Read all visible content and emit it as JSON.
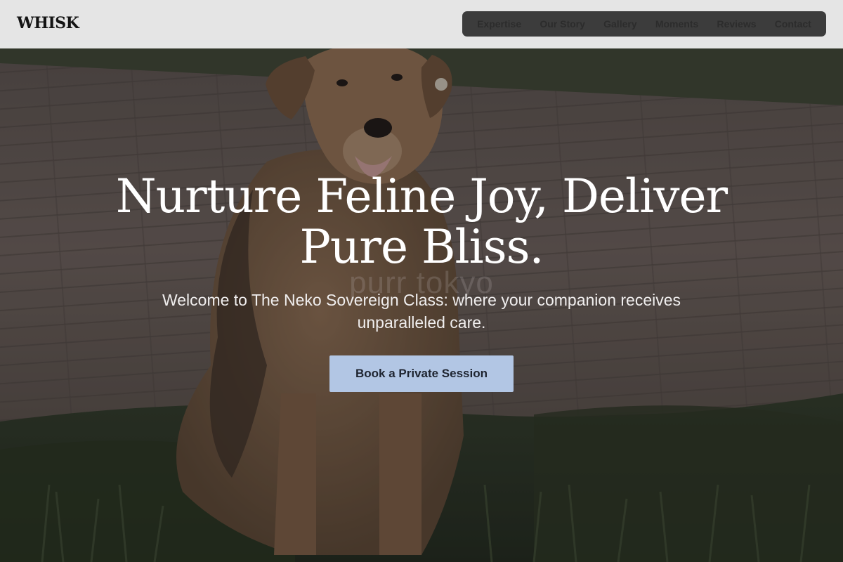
{
  "header": {
    "logo_text": "WHISK",
    "nav": [
      {
        "label": "Expertise"
      },
      {
        "label": "Our Story"
      },
      {
        "label": "Gallery"
      },
      {
        "label": "Moments"
      },
      {
        "label": "Reviews"
      },
      {
        "label": "Contact"
      }
    ]
  },
  "hero": {
    "title_line1": "Nurture Feline Joy, Deliver",
    "title_line2": "Pure Bliss.",
    "watermark": "purr tokyo",
    "subtitle_line1": "Welcome to The Neko Sovereign Class: where your companion receives",
    "subtitle_line2": "unparalleled care.",
    "cta_label": "Book a Private Session",
    "background_image": "dog-sitting-on-grass-photo"
  },
  "colors": {
    "header_bg": "#ecedee",
    "nav_bg": "#3c3c3c",
    "nav_text": "#2c2c2c",
    "cta_bg": "#b2c6e4",
    "title_text": "#ffffff"
  }
}
